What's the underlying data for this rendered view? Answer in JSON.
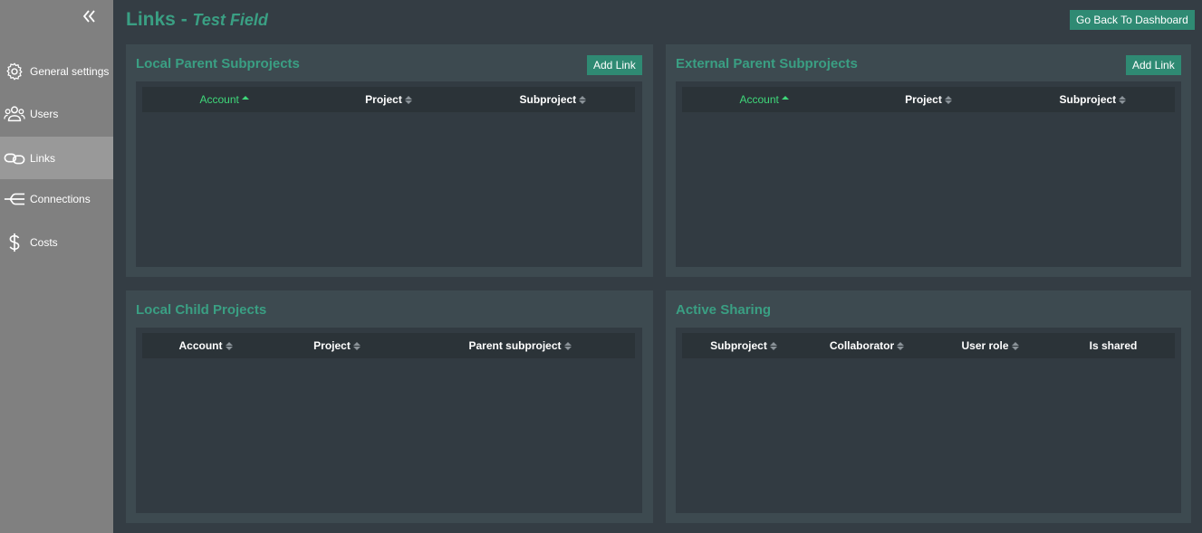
{
  "sidebar": {
    "items": [
      {
        "label": "General settings",
        "icon": "gear-icon"
      },
      {
        "label": "Users",
        "icon": "users-icon"
      },
      {
        "label": "Links",
        "icon": "link-icon",
        "active": true
      },
      {
        "label": "Connections",
        "icon": "connections-icon"
      },
      {
        "label": "Costs",
        "icon": "dollar-icon"
      }
    ]
  },
  "header": {
    "title": "Links",
    "separator": " - ",
    "subtitle": "Test Field",
    "back_button": "Go Back To Dashboard"
  },
  "panels": {
    "local_parent": {
      "title": "Local Parent Subprojects",
      "add_button": "Add Link",
      "columns": [
        "Account",
        "Project",
        "Subproject"
      ]
    },
    "external_parent": {
      "title": "External Parent Subprojects",
      "add_button": "Add Link",
      "columns": [
        "Account",
        "Project",
        "Subproject"
      ]
    },
    "local_child": {
      "title": "Local Child Projects",
      "columns": [
        "Account",
        "Project",
        "Parent subproject"
      ]
    },
    "active_sharing": {
      "title": "Active Sharing",
      "columns": [
        "Subproject",
        "Collaborator",
        "User role",
        "Is shared"
      ]
    }
  },
  "colors": {
    "accent": "#3a9f83",
    "button": "#2f8a73",
    "sorted": "#3fd97a",
    "sidebar": "#808080",
    "background": "#343d44"
  }
}
